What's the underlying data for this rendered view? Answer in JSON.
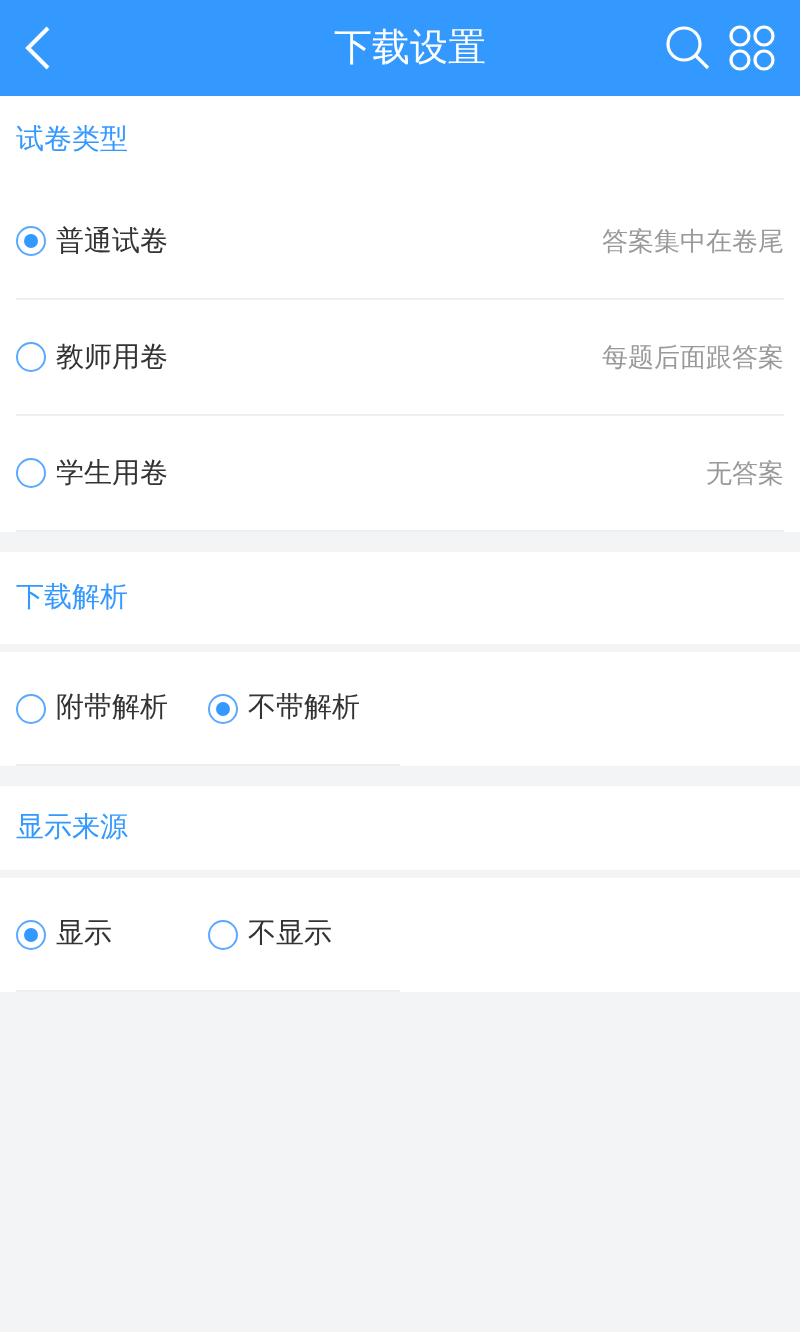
{
  "header": {
    "title": "下载设置"
  },
  "paper_type": {
    "title": "试卷类型",
    "options": [
      {
        "label": "普通试卷",
        "note": "答案集中在卷尾",
        "selected": true
      },
      {
        "label": "教师用卷",
        "note": "每题后面跟答案",
        "selected": false
      },
      {
        "label": "学生用卷",
        "note": "无答案",
        "selected": false
      }
    ]
  },
  "groups": [
    {
      "title": "下载解析",
      "options": [
        {
          "label": "附带解析",
          "selected": false
        },
        {
          "label": "不带解析",
          "selected": true
        }
      ]
    },
    {
      "title": "显示来源",
      "options": [
        {
          "label": "显示",
          "selected": true
        },
        {
          "label": "不显示",
          "selected": false
        }
      ]
    }
  ]
}
